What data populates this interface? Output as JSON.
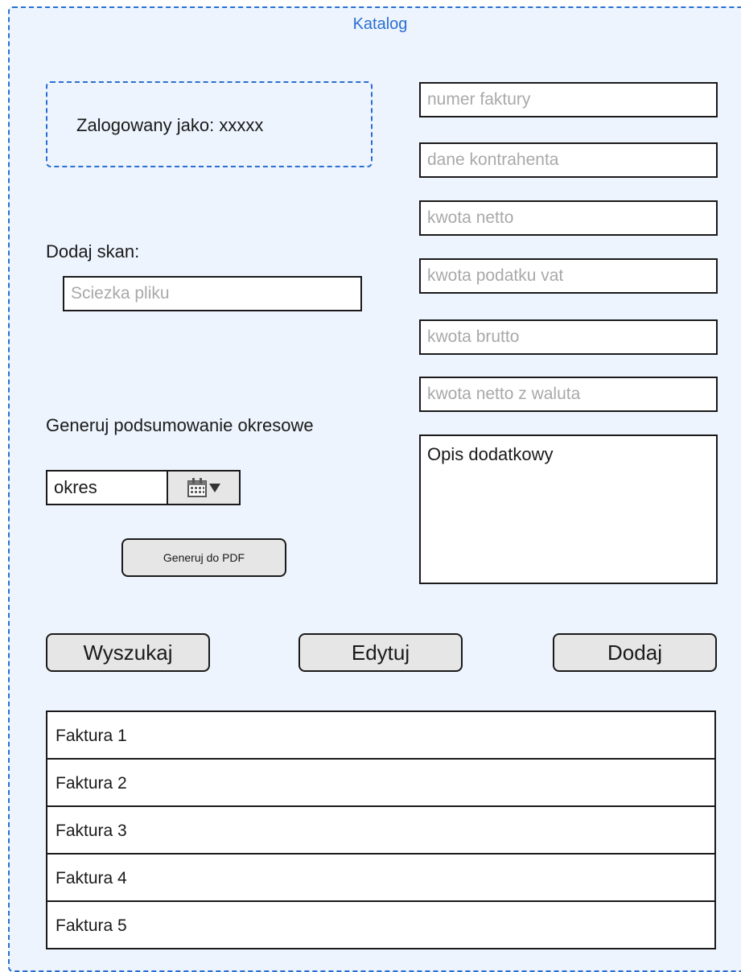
{
  "window": {
    "title": "Katalog"
  },
  "user": {
    "logged_in_text": "Zalogowany jako: xxxxx"
  },
  "scan": {
    "label": "Dodaj skan:",
    "path_placeholder": "Sciezka pliku"
  },
  "invoice_form": {
    "number_placeholder": "numer faktury",
    "contractor_placeholder": "dane kontrahenta",
    "net_placeholder": "kwota netto",
    "vat_placeholder": "kwota podatku vat",
    "gross_placeholder": "kwota brutto",
    "net_currency_placeholder": "kwota netto z waluta",
    "description": "Opis dodatkowy"
  },
  "summary": {
    "label": "Generuj podsumowanie okresowe",
    "period_value": "okres",
    "pdf_button": "Generuj do PDF"
  },
  "actions": {
    "search": "Wyszukaj",
    "edit": "Edytuj",
    "add": "Dodaj"
  },
  "invoices": [
    "Faktura 1",
    "Faktura 2",
    "Faktura 3",
    "Faktura 4",
    "Faktura 5"
  ],
  "colors": {
    "accent": "#2a6fd1",
    "panel_background": "#edf4fd",
    "button_background": "#e6e6e6",
    "placeholder": "#a9a9a9"
  },
  "icons": {
    "period_picker": "calendar-icon",
    "period_dropdown": "chevron-down-icon"
  }
}
